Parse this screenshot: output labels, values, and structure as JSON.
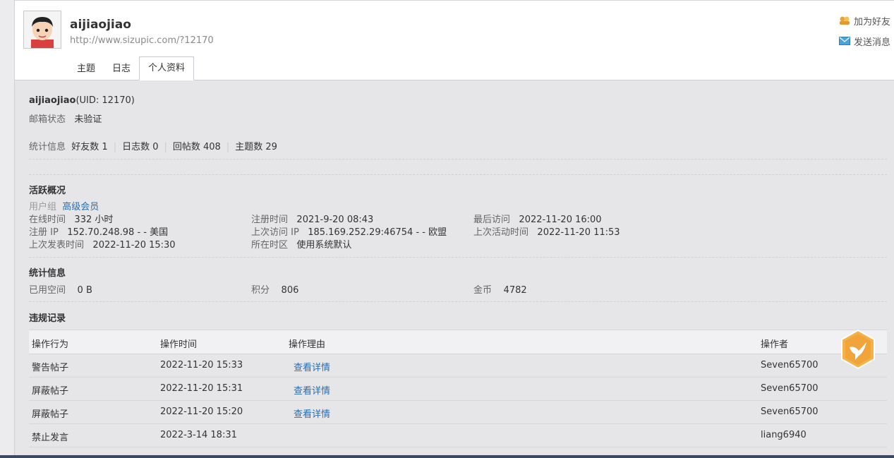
{
  "profile": {
    "username": "aijiaojiao",
    "url": "http://www.sizupic.com/?12170",
    "uid_text": "(UID: 12170)"
  },
  "tabs": [
    {
      "label": "主题"
    },
    {
      "label": "日志"
    },
    {
      "label": "个人资料",
      "active": true
    }
  ],
  "actions": {
    "add_friend": "加为好友",
    "send_message": "发送消息"
  },
  "basic": {
    "email_label": "邮箱状态",
    "email_value": "未验证",
    "stats_label": "统计信息",
    "stats": [
      "好友数 1",
      "日志数 0",
      "回帖数 408",
      "主题数 29"
    ]
  },
  "activity": {
    "title": "活跃概况",
    "usergroup_label": "用户组",
    "usergroup_value": "高级会员",
    "online_label": "在线时间",
    "online_value": "332 小时",
    "reg_time_label": "注册时间",
    "reg_time_value": "2021-9-20 08:43",
    "last_visit_label": "最后访问",
    "last_visit_value": "2022-11-20 16:00",
    "reg_ip_label": "注册 IP",
    "reg_ip_value": "152.70.248.98 - - 美国",
    "last_ip_label": "上次访问 IP",
    "last_ip_value": "185.169.252.29:46754 - - 欧盟",
    "last_active_label": "上次活动时间",
    "last_active_value": "2022-11-20 11:53",
    "last_post_label": "上次发表时间",
    "last_post_value": "2022-11-20 15:30",
    "timezone_label": "所在时区",
    "timezone_value": "使用系统默认"
  },
  "statistics": {
    "title": "统计信息",
    "space_label": "已用空间",
    "space_value": "0 B",
    "points_label": "积分",
    "points_value": "806",
    "coins_label": "金币",
    "coins_value": "4782"
  },
  "violations": {
    "title": "违规记录",
    "headers": [
      "操作行为",
      "操作时间",
      "操作理由",
      "操作者"
    ],
    "rows": [
      {
        "action": "警告帖子",
        "time": "2022-11-20 15:33",
        "reason": "查看详情",
        "operator": "Seven65700"
      },
      {
        "action": "屏蔽帖子",
        "time": "2022-11-20 15:31",
        "reason": "查看详情",
        "operator": "Seven65700"
      },
      {
        "action": "屏蔽帖子",
        "time": "2022-11-20 15:20",
        "reason": "查看详情",
        "operator": "Seven65700"
      },
      {
        "action": "禁止发言",
        "time": "2022-3-14 18:31",
        "reason": "",
        "operator": "liang6940"
      }
    ]
  },
  "colors": {
    "link": "#2a6db0",
    "badge": "#f0a43a"
  }
}
